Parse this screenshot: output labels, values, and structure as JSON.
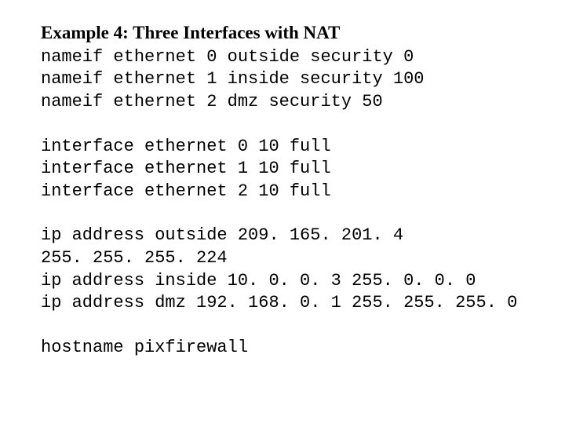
{
  "heading": "Example 4: Three Interfaces with NAT",
  "block1": "nameif ethernet 0 outside security 0\nnameif ethernet 1 inside security 100\nnameif ethernet 2 dmz security 50",
  "block2": "interface ethernet 0 10 full\ninterface ethernet 1 10 full\ninterface ethernet 2 10 full",
  "block3": "ip address outside 209. 165. 201. 4\n255. 255. 255. 224\nip address inside 10. 0. 0. 3 255. 0. 0. 0\nip address dmz 192. 168. 0. 1 255. 255. 255. 0",
  "block4": "hostname pixfirewall"
}
